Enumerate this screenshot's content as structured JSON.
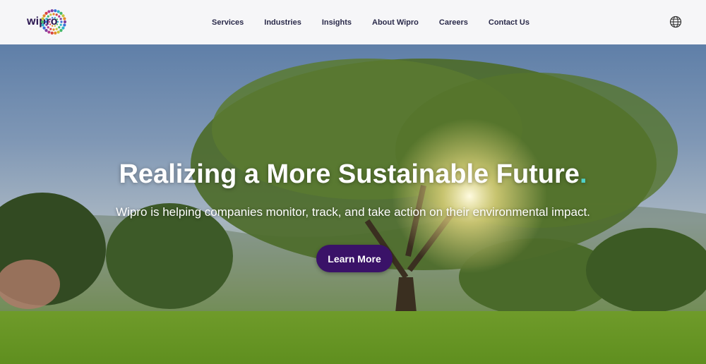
{
  "header": {
    "logo_text": "wipro",
    "nav": [
      "Services",
      "Industries",
      "Insights",
      "About Wipro",
      "Careers",
      "Contact Us"
    ],
    "language_icon": "globe-icon"
  },
  "hero": {
    "title": "Realizing a More Sustainable Future",
    "title_dot": ".",
    "subtitle": "Wipro is helping companies monitor, track, and take action on their environmental impact.",
    "cta_label": "Learn More"
  },
  "colors": {
    "brand_purple": "#3a1268",
    "accent_teal": "#4fd1c9",
    "nav_text": "#2a2a4a"
  }
}
